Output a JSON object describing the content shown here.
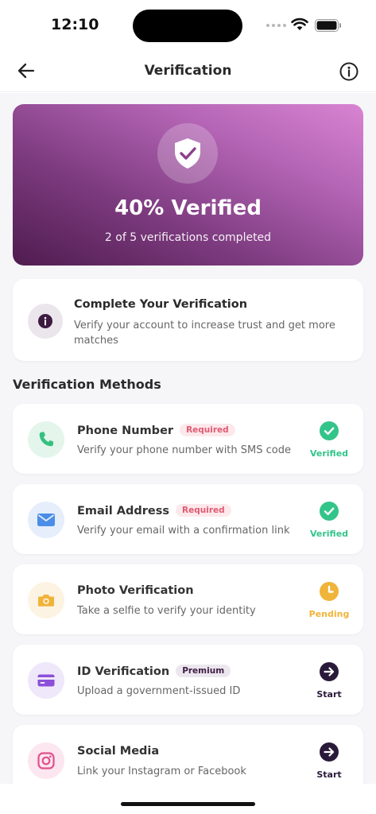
{
  "status_bar": {
    "time": "12:10"
  },
  "nav": {
    "title": "Verification",
    "back_icon": "arrow-left-icon",
    "info_icon": "info-circle-icon"
  },
  "hero": {
    "icon": "shield-check-icon",
    "title": "40% Verified",
    "subtitle": "2 of 5 verifications completed",
    "percent_verified": 40,
    "completed": 2,
    "total": 5
  },
  "info_card": {
    "icon": "info-icon",
    "title": "Complete Your Verification",
    "description": "Verify your account to increase trust and get more matches"
  },
  "section": {
    "title": "Verification Methods"
  },
  "methods": [
    {
      "name": "Phone Number",
      "tag": "Required",
      "description": "Verify your phone number with SMS code",
      "status": "Verified",
      "icon": "phone-icon",
      "icon_color": "#35c07f",
      "icon_bg": "#e4f6ec"
    },
    {
      "name": "Email Address",
      "tag": "Required",
      "description": "Verify your email with a confirmation link",
      "status": "Verified",
      "icon": "email-icon",
      "icon_color": "#4a8ee8",
      "icon_bg": "#e6eefb"
    },
    {
      "name": "Photo Verification",
      "tag": "",
      "description": "Take a selfie to verify your identity",
      "status": "Pending",
      "icon": "camera-icon",
      "icon_color": "#f0b43a",
      "icon_bg": "#fdf3e2"
    },
    {
      "name": "ID Verification",
      "tag": "Premium",
      "description": "Upload a government-issued ID",
      "status": "Start",
      "icon": "id-card-icon",
      "icon_color": "#8b4fd8",
      "icon_bg": "#efe7fa"
    },
    {
      "name": "Social Media",
      "tag": "",
      "description": "Link your Instagram or Facebook",
      "status": "Start",
      "icon": "instagram-icon",
      "icon_color": "#e0508e",
      "icon_bg": "#fce6ef"
    }
  ],
  "colors": {
    "verified": "#33c48a",
    "pending": "#f0b43a",
    "start": "#2a1a3a",
    "brand_dark": "#4f1c4f",
    "brand_light": "#d884d2"
  }
}
